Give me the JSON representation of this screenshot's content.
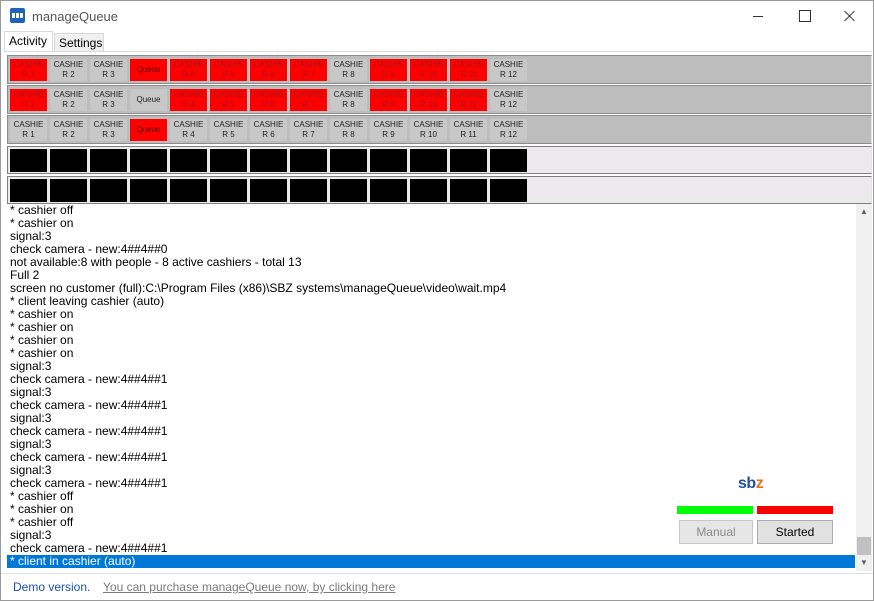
{
  "window": {
    "title": "manageQueue",
    "icon": "app-icon"
  },
  "tabs": [
    {
      "label": "Activity",
      "active": true
    },
    {
      "label": "Settings",
      "active": false
    }
  ],
  "cashier_rows": [
    [
      {
        "line1": "CASHIE",
        "line2": "R 1",
        "state": "red"
      },
      {
        "line1": "CASHIE",
        "line2": "R 2",
        "state": "gray"
      },
      {
        "line1": "CASHIE",
        "line2": "R 3",
        "state": "gray"
      },
      {
        "line1": "Queue",
        "line2": "",
        "state": "red",
        "queue": true
      },
      {
        "line1": "CASHIE",
        "line2": "R 4",
        "state": "red"
      },
      {
        "line1": "CASHIE",
        "line2": "R 5",
        "state": "red"
      },
      {
        "line1": "CASHIE",
        "line2": "R 6",
        "state": "red"
      },
      {
        "line1": "CASHIE",
        "line2": "R 7",
        "state": "red"
      },
      {
        "line1": "CASHIE",
        "line2": "R 8",
        "state": "gray"
      },
      {
        "line1": "CASHIE",
        "line2": "R 9",
        "state": "red"
      },
      {
        "line1": "CASHIE",
        "line2": "R 10",
        "state": "red"
      },
      {
        "line1": "CASHIE",
        "line2": "R 11",
        "state": "red"
      },
      {
        "line1": "CASHIE",
        "line2": "R 12",
        "state": "gray"
      }
    ],
    [
      {
        "line1": "CASHIE",
        "line2": "R 1",
        "state": "red"
      },
      {
        "line1": "CASHIE",
        "line2": "R 2",
        "state": "gray"
      },
      {
        "line1": "CASHIE",
        "line2": "R 3",
        "state": "gray"
      },
      {
        "line1": "Queue",
        "line2": "",
        "state": "gray",
        "queue": true
      },
      {
        "line1": "CASHIE",
        "line2": "R 4",
        "state": "red"
      },
      {
        "line1": "CASHIE",
        "line2": "R 5",
        "state": "red"
      },
      {
        "line1": "CASHIE",
        "line2": "R 6",
        "state": "red"
      },
      {
        "line1": "CASHIE",
        "line2": "R 7",
        "state": "red"
      },
      {
        "line1": "CASHIE",
        "line2": "R 8",
        "state": "gray"
      },
      {
        "line1": "CASHIE",
        "line2": "R 9",
        "state": "red"
      },
      {
        "line1": "CASHIE",
        "line2": "R 10",
        "state": "red"
      },
      {
        "line1": "CASHIE",
        "line2": "R 11",
        "state": "red"
      },
      {
        "line1": "CASHIE",
        "line2": "R 12",
        "state": "gray"
      }
    ],
    [
      {
        "line1": "CASHIE",
        "line2": "R 1",
        "state": "gray"
      },
      {
        "line1": "CASHIE",
        "line2": "R 2",
        "state": "gray"
      },
      {
        "line1": "CASHIE",
        "line2": "R 3",
        "state": "gray"
      },
      {
        "line1": "Queue",
        "line2": "",
        "state": "red",
        "queue": true
      },
      {
        "line1": "CASHIE",
        "line2": "R 4",
        "state": "gray"
      },
      {
        "line1": "CASHIE",
        "line2": "R 5",
        "state": "gray"
      },
      {
        "line1": "CASHIE",
        "line2": "R 6",
        "state": "gray"
      },
      {
        "line1": "CASHIE",
        "line2": "R 7",
        "state": "gray"
      },
      {
        "line1": "CASHIE",
        "line2": "R 8",
        "state": "gray"
      },
      {
        "line1": "CASHIE",
        "line2": "R 9",
        "state": "gray"
      },
      {
        "line1": "CASHIE",
        "line2": "R 10",
        "state": "gray"
      },
      {
        "line1": "CASHIE",
        "line2": "R 11",
        "state": "gray"
      },
      {
        "line1": "CASHIE",
        "line2": "R 12",
        "state": "gray"
      }
    ]
  ],
  "camera_rows": [
    13,
    13
  ],
  "log_lines": [
    "* cashier off",
    "* cashier on",
    "signal:3",
    "check camera - new:4##4##0",
    "not available:8 with people - 8 active cashiers - total 13",
    "Full 2",
    "screen no customer (full):C:\\Program Files (x86)\\SBZ systems\\manageQueue\\video\\wait.mp4",
    "* client leaving cashier (auto)",
    "* cashier on",
    "* cashier on",
    "* cashier on",
    "* cashier on",
    "signal:3",
    "check camera - new:4##4##1",
    "signal:3",
    "check camera - new:4##4##1",
    "signal:3",
    "check camera - new:4##4##1",
    "signal:3",
    "check camera - new:4##4##1",
    "signal:3",
    "check camera - new:4##4##1",
    "* cashier off",
    "* cashier on",
    "* cashier off",
    "signal:3",
    "check camera - new:4##4##1",
    "* client in cashier (auto)"
  ],
  "selected_log_index": 27,
  "logo": {
    "s": "s",
    "b": "b",
    "z": "z"
  },
  "indicators": {
    "left": "#00ff00",
    "right": "#ff0000"
  },
  "buttons": {
    "manual": "Manual",
    "started": "Started"
  },
  "footer": {
    "demo": "Demo version.",
    "purchase": "You can purchase manageQueue now, by clicking here"
  },
  "colors": {
    "red": "#ff0000",
    "gray": "#c8c8c8",
    "selection": "#0078d7",
    "link": "#1b4fb3"
  }
}
